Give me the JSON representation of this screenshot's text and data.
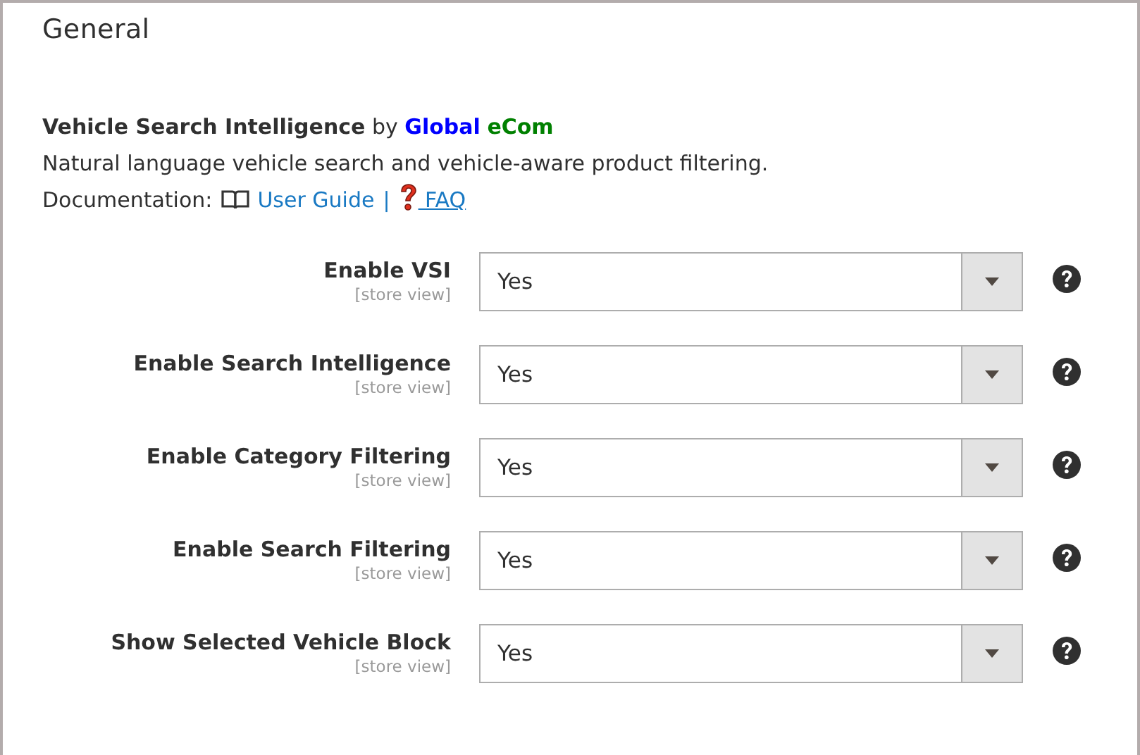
{
  "section": {
    "title": "General"
  },
  "intro": {
    "product": "Vehicle Search Intelligence",
    "by": "by",
    "vendor": [
      {
        "text": "Global",
        "color": "#0000ff"
      },
      {
        "text": "eCom",
        "color": "#008000"
      }
    ],
    "description": "Natural language vehicle search and vehicle-aware product filtering.",
    "docs_label": "Documentation:",
    "links": [
      {
        "kind": "guide",
        "text": "User Guide"
      },
      {
        "kind": "faq",
        "text": "FAQ"
      }
    ],
    "separator": "|"
  },
  "fields": [
    {
      "label": "Enable VSI",
      "scope": "[store view]",
      "value": "Yes"
    },
    {
      "label": "Enable Search Intelligence",
      "scope": "[store view]",
      "value": "Yes"
    },
    {
      "label": "Enable Category Filtering",
      "scope": "[store view]",
      "value": "Yes"
    },
    {
      "label": "Enable Search Filtering",
      "scope": "[store view]",
      "value": "Yes"
    },
    {
      "label": "Show Selected Vehicle Block",
      "scope": "[store view]",
      "value": "Yes"
    }
  ]
}
